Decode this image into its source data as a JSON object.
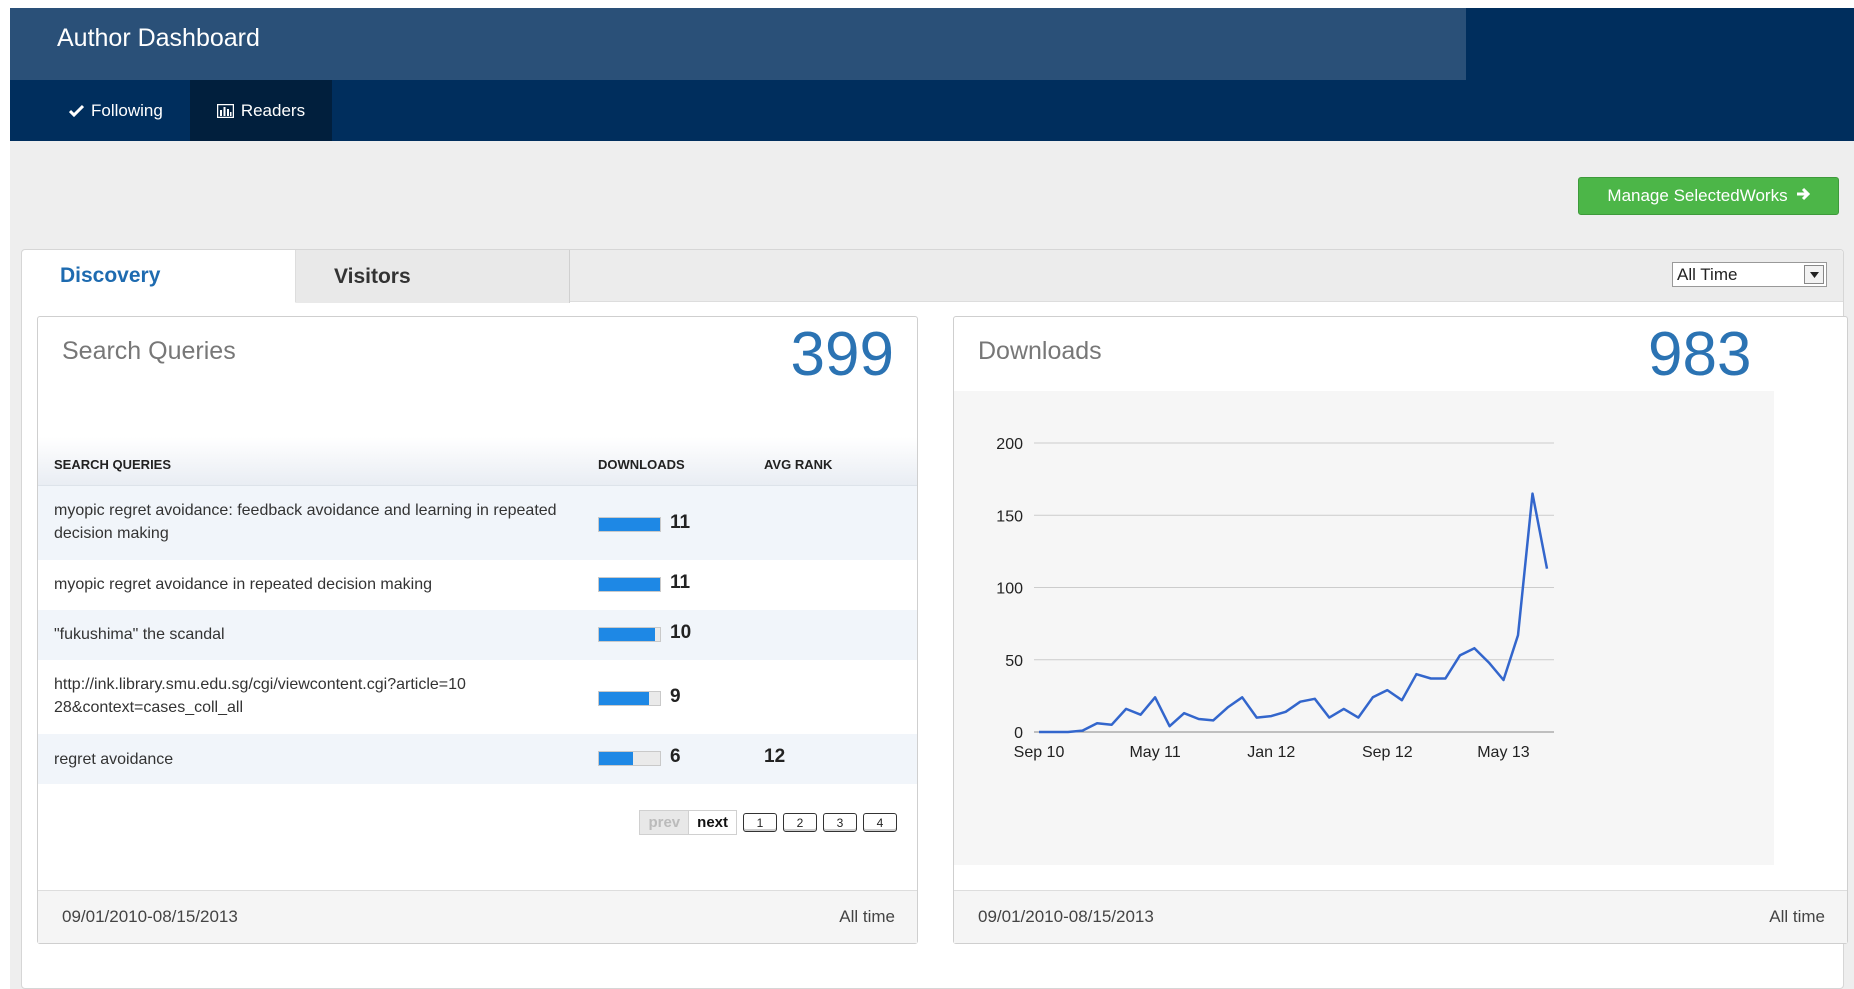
{
  "header": {
    "title": "Author Dashboard",
    "nav": [
      {
        "label": "Following",
        "icon": "checkmark-icon"
      },
      {
        "label": "Readers",
        "icon": "bar-chart-icon"
      }
    ]
  },
  "actions": {
    "manage_label": "Manage SelectedWorks",
    "manage_icon": "arrow-right-icon"
  },
  "tabs": [
    {
      "label": "Discovery",
      "active": true
    },
    {
      "label": "Visitors",
      "active": false
    }
  ],
  "time_filter": {
    "selected": "All Time"
  },
  "search_panel": {
    "title": "Search Queries",
    "count": "399",
    "columns": [
      "SEARCH QUERIES",
      "DOWNLOADS",
      "AVG RANK"
    ],
    "rows": [
      {
        "query": "myopic regret avoidance: feedback avoidance and learning in repeated decision making",
        "downloads": "11",
        "fill": 1.0,
        "avg_rank": ""
      },
      {
        "query": "myopic regret avoidance in repeated decision making",
        "downloads": "11",
        "fill": 1.0,
        "avg_rank": ""
      },
      {
        "query": "\"fukushima\" the scandal",
        "downloads": "10",
        "fill": 0.91,
        "avg_rank": ""
      },
      {
        "query": "http://ink.library.smu.edu.sg/cgi/viewcontent.cgi?article=1028&context=cases_coll_all",
        "downloads": "9",
        "fill": 0.82,
        "avg_rank": ""
      },
      {
        "query": "regret avoidance",
        "downloads": "6",
        "fill": 0.55,
        "avg_rank": "12"
      }
    ],
    "pager": {
      "prev": "prev",
      "next": "next",
      "pages": [
        "1",
        "2",
        "3",
        "4"
      ]
    },
    "footer_range": "09/01/2010-08/15/2013",
    "footer_label": "All time"
  },
  "downloads_panel": {
    "title": "Downloads",
    "count": "983",
    "footer_range": "09/01/2010-08/15/2013",
    "footer_label": "All time"
  },
  "chart_data": {
    "type": "line",
    "title": "",
    "xlabel": "",
    "ylabel": "",
    "ylim": [
      0,
      200
    ],
    "yticks": [
      0,
      50,
      100,
      150,
      200
    ],
    "x_tick_labels": [
      "Sep 10",
      "May 11",
      "Jan 12",
      "Sep 12",
      "May 13"
    ],
    "x_tick_index": [
      0,
      8,
      16,
      24,
      32
    ],
    "grid": true,
    "color": "#3366cc",
    "series": [
      {
        "values": [
          0,
          0,
          0,
          1,
          6,
          5,
          16,
          12,
          24,
          4,
          13,
          9,
          8,
          17,
          24,
          10,
          11,
          14,
          21,
          23,
          10,
          16,
          10,
          24,
          29,
          22,
          40,
          37,
          37,
          53,
          58,
          48,
          36,
          67,
          165,
          113
        ]
      }
    ]
  }
}
